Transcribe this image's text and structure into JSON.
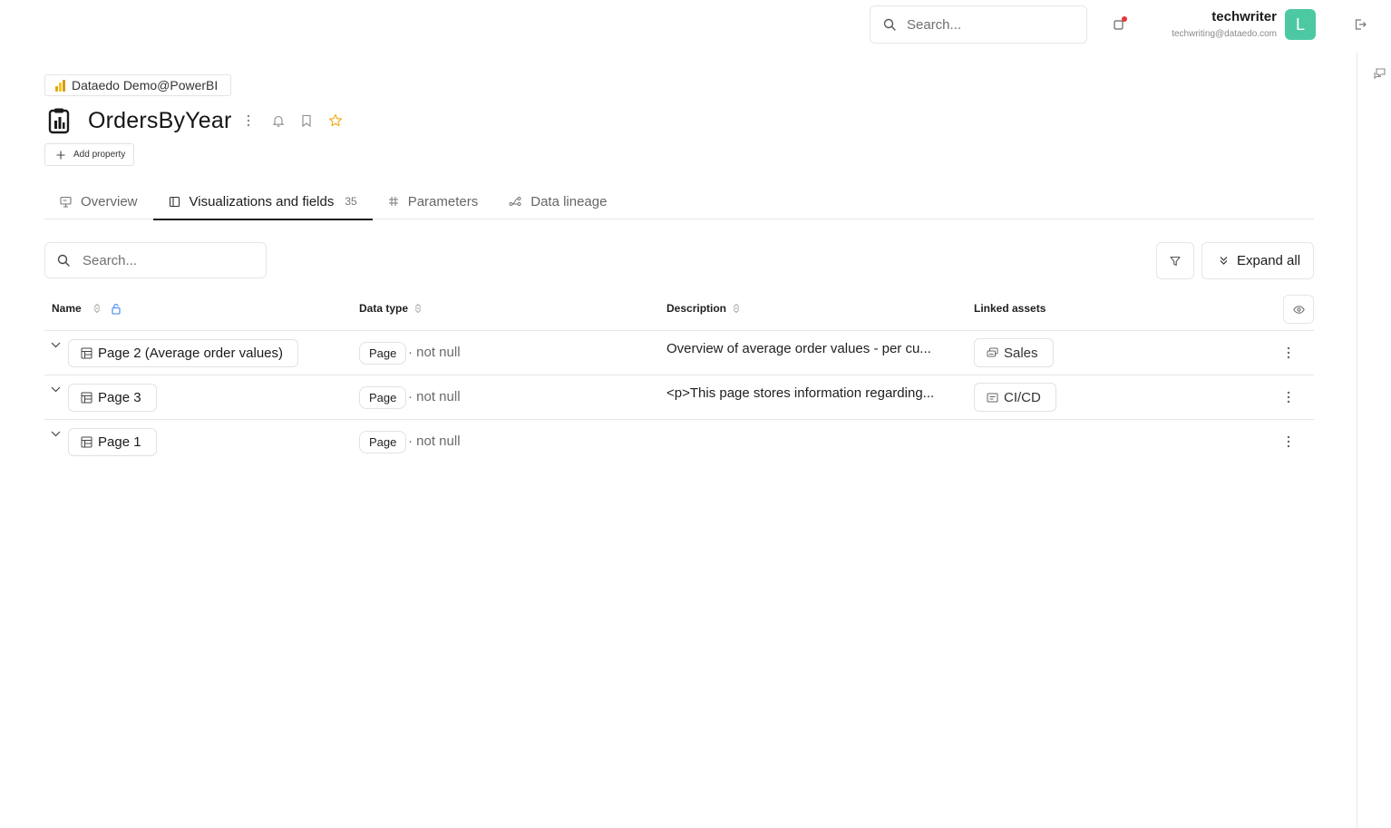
{
  "topbar": {
    "search_placeholder": "Search...",
    "user_name": "techwriter",
    "user_email": "techwriting@dataedo.com",
    "avatar_letter": "L",
    "avatar_color": "#4cc9a3"
  },
  "header": {
    "source": "Dataedo Demo@PowerBI",
    "title": "OrdersByYear",
    "add_property_label": "Add property"
  },
  "tabs": [
    {
      "label": "Overview",
      "icon": "monitor-icon",
      "active": false
    },
    {
      "label": "Visualizations and fields",
      "icon": "book-icon",
      "active": true,
      "count": "35"
    },
    {
      "label": "Parameters",
      "icon": "hash-icon",
      "active": false
    },
    {
      "label": "Data lineage",
      "icon": "lineage-icon",
      "active": false
    }
  ],
  "toolbar": {
    "search_placeholder": "Search...",
    "expand_label": "Expand all"
  },
  "table": {
    "columns": {
      "name": "Name",
      "data_type": "Data type",
      "description": "Description",
      "linked_assets": "Linked assets"
    },
    "rows": [
      {
        "name": "Page 2 (Average order values)",
        "type": "Page",
        "nullable": "· not null",
        "description": "Overview of average order values - per cu...",
        "linked_asset": "Sales",
        "linked_asset_icon": "report-icon"
      },
      {
        "name": "Page 3",
        "type": "Page",
        "nullable": "· not null",
        "description": "<p>This page stores information regarding...",
        "linked_asset": "CI/CD",
        "linked_asset_icon": "list-icon"
      },
      {
        "name": "Page 1",
        "type": "Page",
        "nullable": "· not null",
        "description": "",
        "linked_asset": ""
      }
    ]
  },
  "colors": {
    "accent_star": "#f2b01e",
    "notification_dot": "#e53935",
    "border": "#e6e6e6"
  }
}
